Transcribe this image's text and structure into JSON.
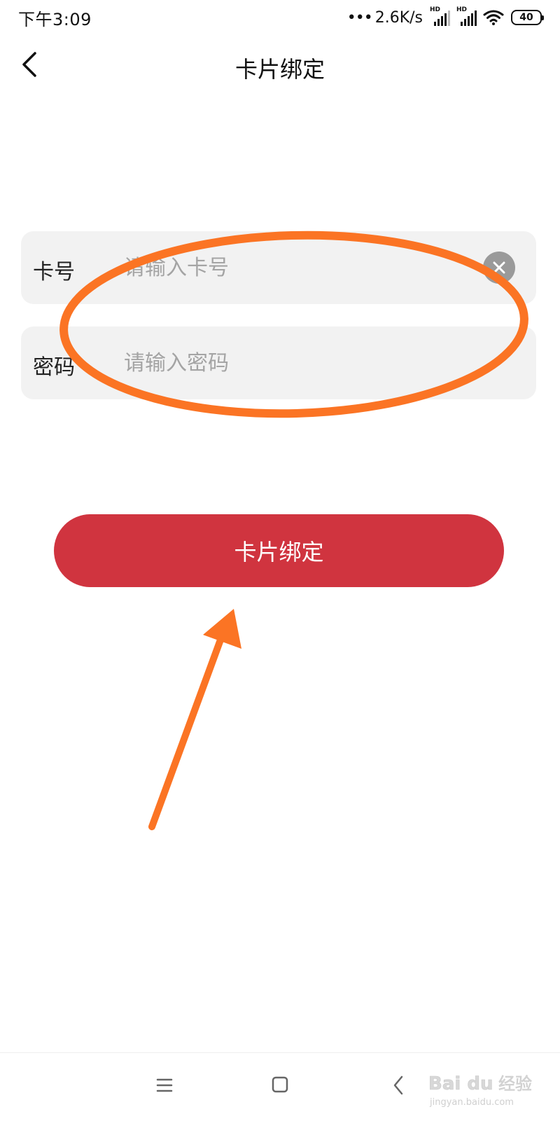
{
  "status_bar": {
    "time": "下午3:09",
    "dots": "•••",
    "network_speed": "2.6K/s",
    "hd_badge": "HD",
    "battery": "40"
  },
  "header": {
    "title": "卡片绑定",
    "back_icon": "chevron-left-icon"
  },
  "form": {
    "card_number": {
      "label": "卡号",
      "value": "",
      "placeholder": "请输入卡号",
      "clear_icon": "close-circle-icon"
    },
    "password": {
      "label": "密码",
      "value": "",
      "placeholder": "请输入密码"
    }
  },
  "submit": {
    "label": "卡片绑定"
  },
  "nav_bar": {
    "menu_icon": "menu-icon",
    "home_icon": "home-square-icon",
    "back_icon": "back-icon"
  },
  "watermark": {
    "brand": "Bai du",
    "brand_suffix": "经验",
    "url": "jingyan.baidu.com"
  },
  "colors": {
    "primary_button": "#d0343f",
    "input_bg": "#f2f2f2",
    "annotation": "#fb7424",
    "placeholder": "#a4a4a4"
  }
}
